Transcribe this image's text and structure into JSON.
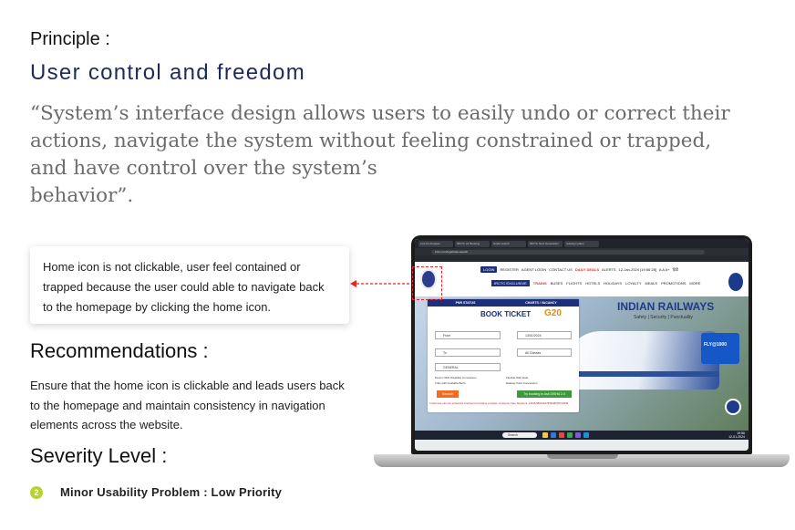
{
  "principle": {
    "label": "Principle :",
    "title": "User control and freedom",
    "quote_lines": [
      "“System’s interface design allows users to easily undo or correct their",
      "actions, navigate the system without feeling constrained or trapped,",
      "and have control over the system’s",
      "behavior”."
    ]
  },
  "callout": {
    "lines": [
      "Home icon is not clickable, user feel contained or",
      "trapped because the user could able to navigate back",
      "to the homepage by clicking the home icon."
    ]
  },
  "recommendations": {
    "heading": "Recommendations :",
    "lines": [
      "Ensure that the home icon is clickable and leads users back",
      "to the homepage and maintain consistency in navigation",
      "elements across the website."
    ]
  },
  "severity": {
    "heading": "Severity Level :",
    "badge": "2",
    "text": "Minor Usability Problem : Low Priority",
    "badge_color": "#b8d42c"
  },
  "screenshot": {
    "address": "irctc.co.in/nget/train-search",
    "tabs": [
      "Live for Analysis",
      "IRCTC Air Booking",
      "Guide search",
      "IRCTC Next Generation",
      "redesign plans"
    ],
    "nav": {
      "login": "LOGIN",
      "register": "REGISTER",
      "agent_login": "AGENT LOGIN",
      "contact_us": "CONTACT US",
      "daily_deals": "DAILY DEALS",
      "alerts": "ALERTS",
      "datetime": "12-Jan-2024 [19:56:28]",
      "font_sizes": "A  A  A+",
      "language": "हिंदी"
    },
    "nav2": {
      "exclusive": "IRCTC EXCLUSIVE",
      "items": [
        "TRAINS",
        "BUSES",
        "FLIGHTS",
        "HOTELS",
        "HOLIDAYS",
        "LOYALTY",
        "MEALS",
        "PROMOTIONS",
        "MORE"
      ]
    },
    "hero": {
      "title": "INDIAN RAILWAYS",
      "subtitle": "Safety | Security | Punctuality",
      "promo": "FLY@1000"
    },
    "booking": {
      "tab_pnr": "PNR STATUS",
      "tab_charts": "CHARTS / VACANCY",
      "title": "BOOK TICKET",
      "g20": "G20",
      "from_label": "From",
      "to_label": "To",
      "date": "13/01/2024",
      "classes": "All Classes",
      "quota": "GENERAL",
      "check1": "Person With Disability Concession",
      "check2": "Flexible With Date",
      "check3": "Train with Available Berth",
      "check4": "Railway Pass Concession",
      "search": "Search",
      "ai_button": "Try booking in Ask DISHA 2.0",
      "notice": "Customers can use enhanced interface for booking e-tickets. Customer Care Numbers: 14646/08044647999/08035734999"
    },
    "taskbar": {
      "search": "Search",
      "time": "19:56",
      "date": "12-01-2024"
    }
  }
}
